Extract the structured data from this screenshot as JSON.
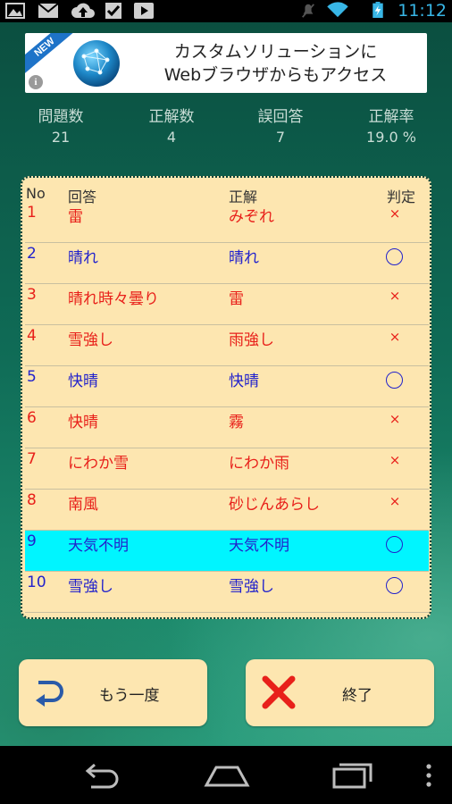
{
  "status_bar": {
    "time": "11:12",
    "icons": [
      "picture-icon",
      "mail-icon",
      "upload-icon",
      "checkbox-icon",
      "play-icon",
      "mute-icon",
      "wifi-icon",
      "battery-charging-icon"
    ]
  },
  "ad": {
    "badge": "NEW",
    "info": "i",
    "line1": "カスタムソリューションに",
    "line2": "Webブラウザからもアクセス"
  },
  "stats": {
    "labels": [
      "問題数",
      "正解数",
      "誤回答",
      "正解率"
    ],
    "values": [
      "21",
      "4",
      "7",
      "19.0 %"
    ]
  },
  "table": {
    "headers": {
      "no": "No",
      "answer": "回答",
      "correct": "正解",
      "judge": "判定"
    },
    "rows": [
      {
        "no": "1",
        "answer": "雷",
        "correct": "みぞれ",
        "judge": "×"
      },
      {
        "no": "2",
        "answer": "晴れ",
        "correct": "晴れ",
        "judge": "○"
      },
      {
        "no": "3",
        "answer": "晴れ時々曇り",
        "correct": "雷",
        "judge": "×"
      },
      {
        "no": "4",
        "answer": "雪強し",
        "correct": "雨強し",
        "judge": "×"
      },
      {
        "no": "5",
        "answer": "快晴",
        "correct": "快晴",
        "judge": "○"
      },
      {
        "no": "6",
        "answer": "快晴",
        "correct": "霧",
        "judge": "×"
      },
      {
        "no": "7",
        "answer": "にわか雪",
        "correct": "にわか雨",
        "judge": "×"
      },
      {
        "no": "8",
        "answer": "南風",
        "correct": "砂じんあらし",
        "judge": "×"
      },
      {
        "no": "9",
        "answer": "天気不明",
        "correct": "天気不明",
        "judge": "○"
      },
      {
        "no": "10",
        "answer": "雪強し",
        "correct": "雪強し",
        "judge": "○"
      }
    ],
    "highlight_row": "9"
  },
  "buttons": {
    "retry": "もう一度",
    "finish": "終了"
  },
  "colors": {
    "wrong": "#e8201a",
    "right": "#2222cc",
    "highlight": "#00f5ff",
    "panel": "#fde6b0"
  }
}
